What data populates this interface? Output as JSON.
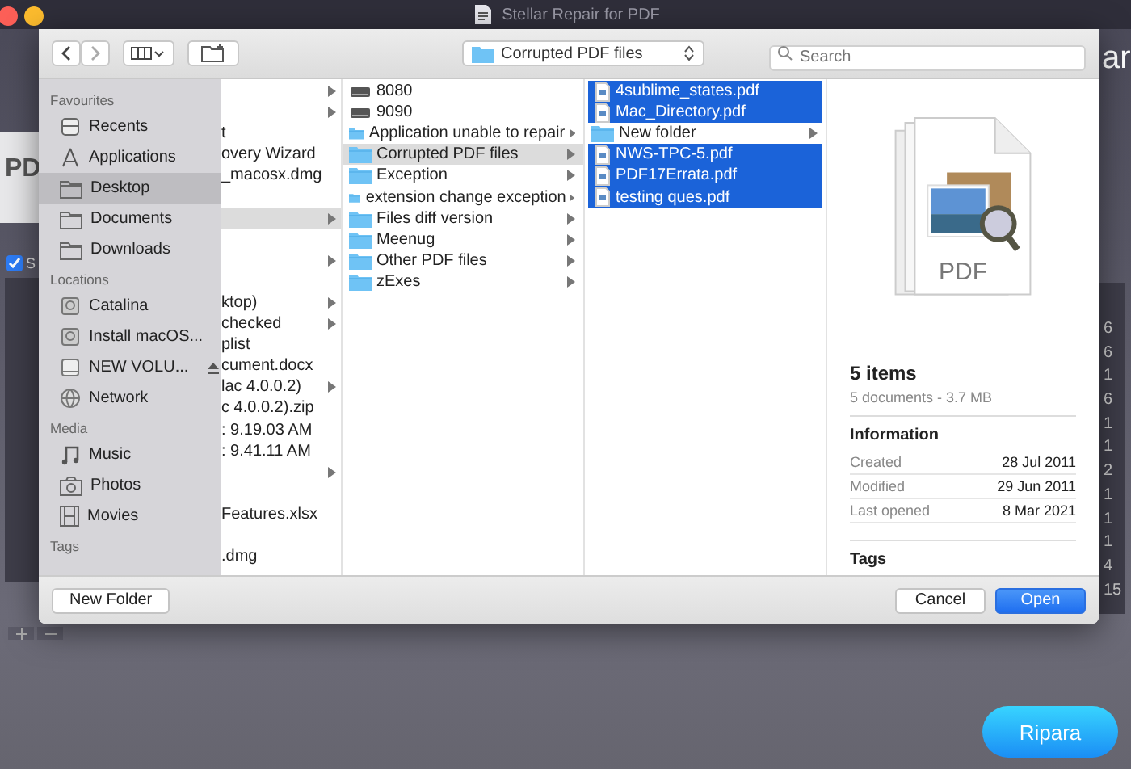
{
  "app": {
    "title": "Stellar Repair for PDF",
    "logo_text": "PD",
    "heading_fragment": "ar",
    "select_all": {
      "label": "S",
      "checked": true
    },
    "table_fragments": [
      "6",
      "6",
      "1",
      "6",
      "1",
      "1",
      "2",
      "1",
      "1",
      "1",
      "4",
      "15"
    ],
    "repair_button": "Ripara"
  },
  "dialog": {
    "location": "Corrupted PDF files",
    "search": {
      "placeholder": "Search"
    },
    "sidebar": [
      {
        "heading": "Favourites",
        "items": [
          {
            "label": "Recents",
            "kind": "clock",
            "selected": false
          },
          {
            "label": "Applications",
            "kind": "apps",
            "selected": false
          },
          {
            "label": "Desktop",
            "kind": "folder",
            "selected": true
          },
          {
            "label": "Documents",
            "kind": "folder",
            "selected": false
          },
          {
            "label": "Downloads",
            "kind": "folder",
            "selected": false
          }
        ]
      },
      {
        "heading": "Locations",
        "items": [
          {
            "label": "Catalina",
            "kind": "disk",
            "selected": false
          },
          {
            "label": "Install macOS...",
            "kind": "disk",
            "selected": false
          },
          {
            "label": "NEW VOLU...",
            "kind": "drive",
            "selected": false,
            "eject": true
          },
          {
            "label": "Network",
            "kind": "globe",
            "selected": false
          }
        ]
      },
      {
        "heading": "Media",
        "items": [
          {
            "label": "Music",
            "kind": "music",
            "selected": false
          },
          {
            "label": "Photos",
            "kind": "camera",
            "selected": false
          },
          {
            "label": "Movies",
            "kind": "film",
            "selected": false
          }
        ]
      },
      {
        "heading": "Tags"
      }
    ],
    "columns": [
      [
        {
          "arrow": true,
          "selected": false
        },
        {
          "arrow": true,
          "selected": false
        },
        {
          "label": "t",
          "arrow": false,
          "selected": false
        },
        {
          "label": "overy Wizard",
          "arrow": false,
          "selected": false
        },
        {
          "label": "_macosx.dmg",
          "arrow": false,
          "selected": false
        },
        {
          "arrow": false,
          "selected": false
        },
        {
          "arrow": true,
          "selected": true
        },
        {
          "arrow": false,
          "selected": false
        },
        {
          "arrow": true,
          "selected": false
        },
        {
          "arrow": false,
          "selected": false
        },
        {
          "label": "ktop)",
          "arrow": true,
          "selected": false
        },
        {
          "label": "checked",
          "arrow": true,
          "selected": false
        },
        {
          "label": "plist",
          "arrow": false,
          "selected": false
        },
        {
          "label": "cument.docx",
          "arrow": false,
          "selected": false
        },
        {
          "label": "lac 4.0.0.2)",
          "arrow": true,
          "selected": false
        },
        {
          "label": "c 4.0.0.2).zip",
          "arrow": false,
          "selected": false
        },
        {
          "label": ": 9.19.03 AM",
          "arrow": false,
          "selected": false
        },
        {
          "label": ": 9.41.11 AM",
          "arrow": false,
          "selected": false
        },
        {
          "arrow": true,
          "selected": false
        },
        {
          "arrow": false,
          "selected": false
        },
        {
          "label": "Features.xlsx",
          "arrow": false,
          "selected": false
        },
        {
          "arrow": false,
          "selected": false
        },
        {
          "label": ".dmg",
          "arrow": false,
          "selected": false
        }
      ],
      [
        {
          "label": "8080",
          "kind": "drive",
          "arrow": false,
          "selected": false
        },
        {
          "label": "9090",
          "kind": "drive",
          "arrow": false,
          "selected": false
        },
        {
          "label": "Application unable to repair",
          "kind": "folder",
          "arrow": true,
          "selected": false
        },
        {
          "label": "Corrupted PDF files",
          "kind": "folder",
          "arrow": true,
          "selected": true
        },
        {
          "label": "Exception",
          "kind": "folder",
          "arrow": true,
          "selected": false
        },
        {
          "label": "extension change exception",
          "kind": "folder",
          "arrow": true,
          "selected": false
        },
        {
          "label": "Files diff version",
          "kind": "folder",
          "arrow": true,
          "selected": false
        },
        {
          "label": "Meenug",
          "kind": "folder",
          "arrow": true,
          "selected": false
        },
        {
          "label": "Other PDF files",
          "kind": "folder",
          "arrow": true,
          "selected": false
        },
        {
          "label": "zExes",
          "kind": "folder",
          "arrow": true,
          "selected": false
        }
      ],
      [
        {
          "label": "4sublime_states.pdf",
          "kind": "file",
          "arrow": false,
          "selected": true
        },
        {
          "label": "Mac_Directory.pdf",
          "kind": "file",
          "arrow": false,
          "selected": true
        },
        {
          "label": "New folder",
          "kind": "folder",
          "arrow": true,
          "selected": false
        },
        {
          "label": "NWS-TPC-5.pdf",
          "kind": "file",
          "arrow": false,
          "selected": true
        },
        {
          "label": "PDF17Errata.pdf",
          "kind": "file",
          "arrow": false,
          "selected": true
        },
        {
          "label": "testing ques.pdf",
          "kind": "file",
          "arrow": false,
          "selected": true
        }
      ]
    ],
    "preview": {
      "icon_label": "PDF",
      "title": "5 items",
      "subtitle": "5 documents - 3.7 MB",
      "info_heading": "Information",
      "info": [
        {
          "label": "Created",
          "value": "28 Jul 2011"
        },
        {
          "label": "Modified",
          "value": "29 Jun 2011"
        },
        {
          "label": "Last opened",
          "value": "8 Mar 2021"
        }
      ],
      "tags_heading": "Tags"
    },
    "buttons": {
      "new_folder": "New Folder",
      "cancel": "Cancel",
      "open": "Open"
    }
  }
}
